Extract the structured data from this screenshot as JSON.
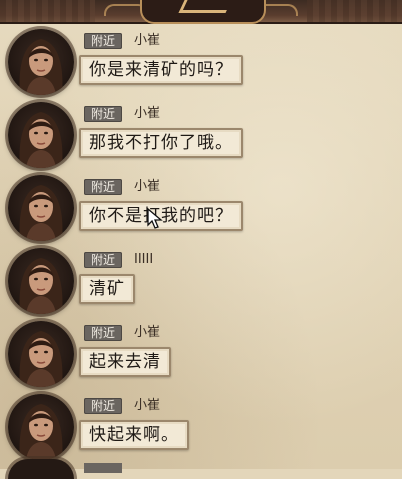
{
  "messages": [
    {
      "channel": "附近",
      "sender": "小崔",
      "text": "你是来清矿的吗？"
    },
    {
      "channel": "附近",
      "sender": "小崔",
      "text": "那我不打你了哦。"
    },
    {
      "channel": "附近",
      "sender": "小崔",
      "text": "你不是打我的吧？"
    },
    {
      "channel": "附近",
      "sender": "IIIII",
      "text": "清矿"
    },
    {
      "channel": "附近",
      "sender": "小崔",
      "text": "起来去清"
    },
    {
      "channel": "附近",
      "sender": "小崔",
      "text": "快起来啊。"
    }
  ],
  "colors": {
    "paper": "#e3d6ba",
    "bubble": "#f2e9d6",
    "bubble_border": "#9b876c",
    "tag": "#6a6560",
    "banner": "#3c2b22"
  },
  "icons": {
    "avatar": "female-character-portrait-icon",
    "cursor": "mouse-pointer-icon"
  }
}
